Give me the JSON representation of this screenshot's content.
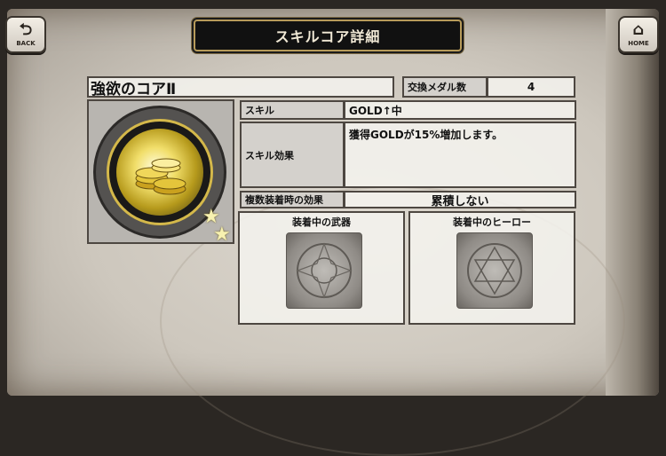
{
  "header": {
    "title": "スキルコア詳細"
  },
  "nav": {
    "back_label": "BACK",
    "home_label": "HOME"
  },
  "core": {
    "name": "強欲のコアⅡ",
    "stars": 2
  },
  "medals": {
    "label": "交換メダル数",
    "value": "4"
  },
  "skill": {
    "label": "スキル",
    "value": "GOLD↑中"
  },
  "effect": {
    "label": "スキル効果",
    "value": "獲得GOLDが15%増加します。"
  },
  "multi": {
    "label": "複数装着時の効果",
    "value": "累積しない"
  },
  "equipped": {
    "weapon_label": "装着中の武器",
    "hero_label": "装着中のヒーロー"
  },
  "icons": [
    "back-arrow-icon",
    "home-icon",
    "gold-coins-icon",
    "star-icon"
  ]
}
